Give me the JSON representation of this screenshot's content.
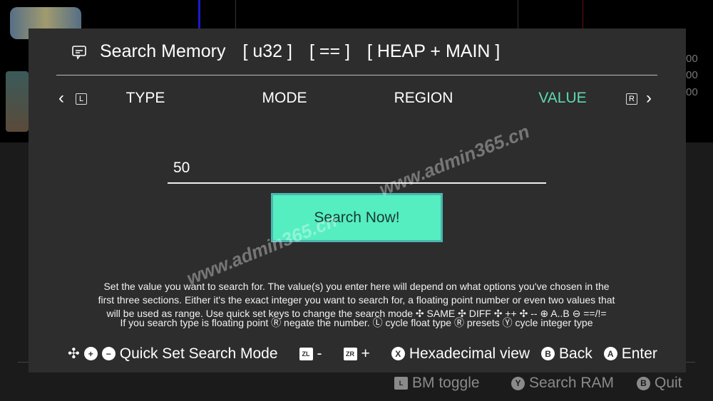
{
  "background": {
    "numbers": [
      "00",
      "00",
      "00"
    ]
  },
  "dialog": {
    "title": "Search Memory",
    "type_tag": "[ u32 ]",
    "mode_tag": "[ == ]",
    "region_tag": "[ HEAP + MAIN ]",
    "tabs": [
      {
        "label": "TYPE",
        "active": false
      },
      {
        "label": "MODE",
        "active": false
      },
      {
        "label": "REGION",
        "active": false
      },
      {
        "label": "VALUE",
        "active": true
      }
    ],
    "tab_left_key": "L",
    "tab_right_key": "R",
    "value_input": "50",
    "search_button": "Search Now!",
    "description": [
      "Set the value you want to search for. The value(s) you enter here will depend on what options you've chosen in the",
      "first three sections. Either it's the exact integer you want to search for, a floating point number or even two values that",
      "will be used as range. Use quick set keys to change the search mode ✣ SAME ✣ DIFF ✣ ++ ✣ -- ⊕ A..B ⊖ ==/!=",
      "If you search type is floating point Ⓡ negate the number. Ⓛ cycle float type Ⓡ presets Ⓨ cycle integer type"
    ],
    "footer": {
      "quick_set": "Quick Set Search Mode",
      "zl_key": "ZL",
      "zl_label": "-",
      "zr_key": "ZR",
      "zr_label": "+",
      "x_key": "X",
      "x_label": "Hexadecimal view",
      "b_key": "B",
      "b_label": "Back",
      "a_key": "A",
      "a_label": "Enter"
    }
  },
  "bottom_bar": {
    "l_key": "L",
    "l_label": "BM toggle",
    "y_key": "Y",
    "y_label": "Search RAM",
    "b_key": "B",
    "b_label": "Quit"
  },
  "watermark": "www.admin365.cn",
  "colors": {
    "accent": "#55eec0",
    "active_tab": "#5fd9b0",
    "panel": "#2d2d2d"
  }
}
